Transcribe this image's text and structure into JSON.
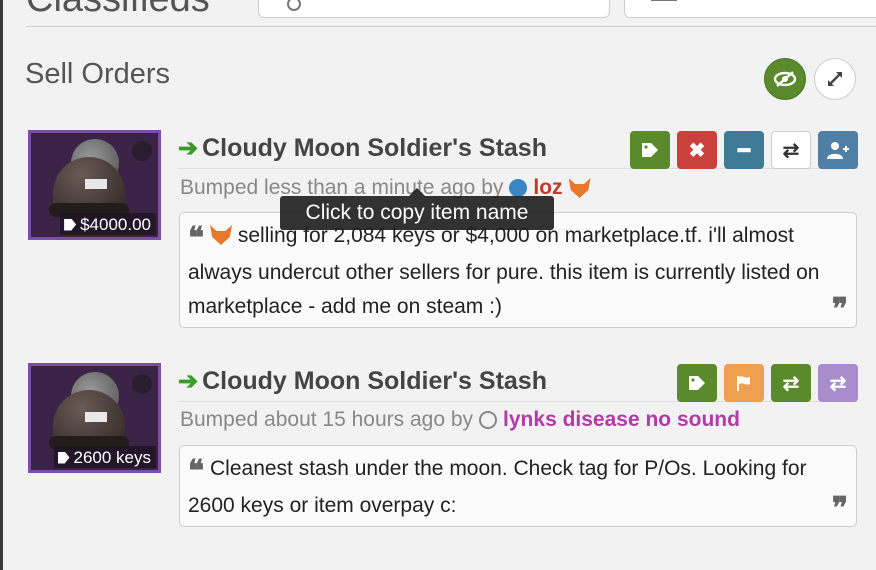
{
  "header": {
    "title": "Classifieds"
  },
  "section": {
    "title": "Sell Orders",
    "buttons": {
      "hide_label": "hide",
      "expand_label": "expand"
    }
  },
  "tooltip": "Click to copy item name",
  "listings": [
    {
      "item_name": "Cloudy Moon Soldier's Stash",
      "price": "$4000.00",
      "bumped_prefix": "Bumped less than a minute ago by",
      "username": "loz",
      "user_status": "online",
      "description": "selling for 2,084 keys or $4,000 on marketplace.tf. i'll almost always undercut other sellers for pure. this item is currently listed on marketplace - add me on steam :)",
      "actions": [
        {
          "icon": "tag-icon",
          "color": "#5b8a2c"
        },
        {
          "icon": "close-icon",
          "color": "#c9413a"
        },
        {
          "icon": "minus-icon",
          "color": "#3e7b96"
        },
        {
          "icon": "retweet-icon",
          "color": "#ffffff"
        },
        {
          "icon": "add-user-icon",
          "color": "#4f7ea6"
        }
      ]
    },
    {
      "item_name": "Cloudy Moon Soldier's Stash",
      "price": "2600 keys",
      "bumped_prefix": "Bumped about 15 hours ago by",
      "username": "lynks disease no sound",
      "user_status": "offline",
      "description": "Cleanest stash under the moon. Check tag for P/Os. Looking for 2600 keys or item overpay c:",
      "actions": [
        {
          "icon": "tag-icon",
          "color": "#5b8a2c"
        },
        {
          "icon": "flag-icon",
          "color": "#eea050"
        },
        {
          "icon": "exchange-icon",
          "color": "#5b8a2c"
        },
        {
          "icon": "exchange-icon",
          "color": "#a98ccc"
        }
      ]
    }
  ]
}
